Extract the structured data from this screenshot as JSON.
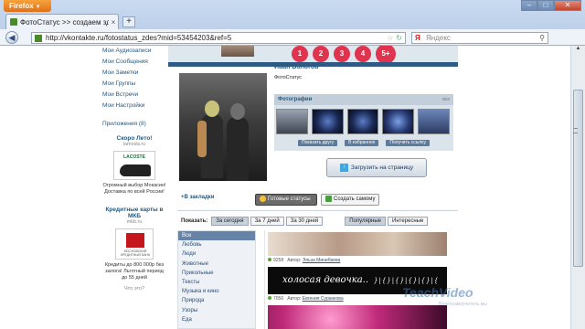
{
  "browser": {
    "menu_button": "Firefox",
    "window_buttons": [
      "–",
      "□",
      "✕"
    ],
    "tab_title": "ФотоСтатус >> создаем здесь ...",
    "new_tab": "+",
    "url": "http://vkontakte.ru/fotostatus_zdes?mid=53454203&ref=5",
    "search_engine": "Яндекс"
  },
  "left_menu": {
    "items": [
      "Мои Аудиозаписи",
      "Мои Сообщения",
      "Мои Заметки",
      "Мои Группы",
      "Мои Встречи",
      "Мои Настройки"
    ],
    "apps_link": "Приложения (8)"
  },
  "ads": [
    {
      "title": "Скоро Лето!",
      "domain": "lamoda.ru",
      "brand": "LACOSTE",
      "text": "Огромный выбор Мокасин! Доставка по всей России!"
    },
    {
      "title": "Кредитные карты в МКБ",
      "domain": "mkb.ru",
      "brand": "МОСКОВСКИЙ КРЕДИТНЫЙ БАНК",
      "text": "Кредиты до 800 000р без залога! Льготный период до 55 дней"
    }
  ],
  "ads_footer": "Что это?",
  "banner": {
    "pages": [
      "1",
      "2",
      "3",
      "4",
      "5+"
    ]
  },
  "profile": {
    "name": "Иван   Бологов",
    "status": "ФотоСтатус"
  },
  "photos": {
    "header": "Фотографии",
    "all_link": "все",
    "actions": [
      "Показать другу",
      "В избранное",
      "Получить ссылку"
    ]
  },
  "upload_button": "Загрузить на страницу",
  "bookmarks_link": "+В закладки",
  "ready_statuses_button": "Готовые статусы",
  "create_button": "Создать самому",
  "show_label": "Показать:",
  "time_filters": [
    "За сегодня",
    "За 7 дней",
    "За 30 дней"
  ],
  "sort_filters": [
    "Популярные",
    "Интересные"
  ],
  "categories": [
    "Все",
    "Любовь",
    "Люди",
    "Животные",
    "Прикольные",
    "Тексты",
    "Музыка и кино",
    "Природа",
    "Узоры",
    "Еда"
  ],
  "feed": [
    {
      "count": "9258",
      "author_label": "Автор:",
      "author": "Эльза Минибаева"
    },
    {
      "count": "7056",
      "author_label": "Автор:",
      "author": "Евгения Суранкова",
      "caption": "холосая девочка..",
      "deco": "}|{}|{}|{}|{}|{"
    }
  ],
  "watermark": {
    "main": "TeachVideo",
    "sub": "Видеосамоучитель мы"
  }
}
